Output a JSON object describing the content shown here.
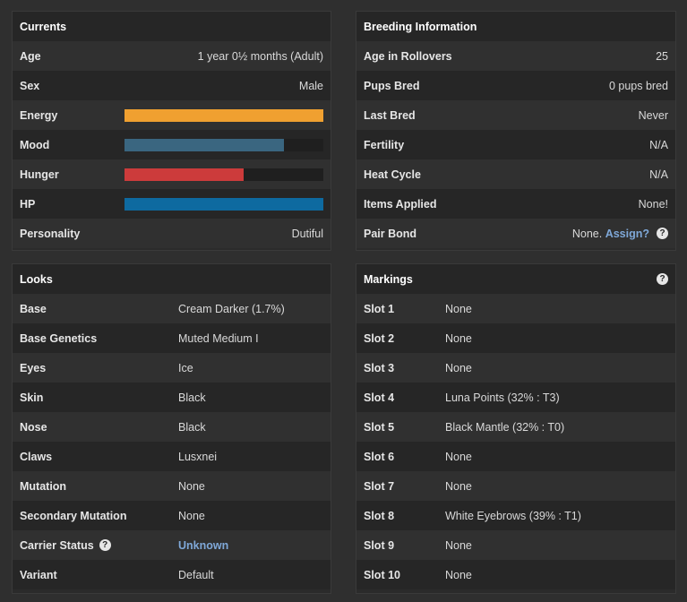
{
  "currents": {
    "title": "Currents",
    "age": {
      "label": "Age",
      "value": "1 year 0½ months (Adult)"
    },
    "sex": {
      "label": "Sex",
      "value": "Male"
    },
    "energy": {
      "label": "Energy",
      "fraction": 1.0,
      "color": "#f0a030"
    },
    "mood": {
      "label": "Mood",
      "fraction": 0.8,
      "color": "#3a6680"
    },
    "hunger": {
      "label": "Hunger",
      "fraction": 0.6,
      "color": "#cc3b3b"
    },
    "hp": {
      "label": "HP",
      "fraction": 1.0,
      "color": "#0e6aa0"
    },
    "personality": {
      "label": "Personality",
      "value": "Dutiful"
    }
  },
  "breeding": {
    "title": "Breeding Information",
    "rows": [
      {
        "label": "Age in Rollovers",
        "value": "25"
      },
      {
        "label": "Pups Bred",
        "value": "0 pups bred"
      },
      {
        "label": "Last Bred",
        "value": "Never"
      },
      {
        "label": "Fertility",
        "value": "N/A"
      },
      {
        "label": "Heat Cycle",
        "value": "N/A"
      },
      {
        "label": "Items Applied",
        "value": "None!"
      }
    ],
    "pair_bond": {
      "label": "Pair Bond",
      "value": "None.",
      "link": "Assign?",
      "help": "?"
    }
  },
  "looks": {
    "title": "Looks",
    "rows": [
      {
        "label": "Base",
        "value": "Cream Darker (1.7%)"
      },
      {
        "label": "Base Genetics",
        "value": "Muted Medium I"
      },
      {
        "label": "Eyes",
        "value": "Ice"
      },
      {
        "label": "Skin",
        "value": "Black"
      },
      {
        "label": "Nose",
        "value": "Black"
      },
      {
        "label": "Claws",
        "value": "Lusxnei"
      },
      {
        "label": "Mutation",
        "value": "None"
      },
      {
        "label": "Secondary Mutation",
        "value": "None"
      }
    ],
    "carrier": {
      "label": "Carrier Status",
      "help": "?",
      "value": "Unknown"
    },
    "variant": {
      "label": "Variant",
      "value": "Default"
    }
  },
  "markings": {
    "title": "Markings",
    "help": "?",
    "rows": [
      {
        "label": "Slot 1",
        "value": "None"
      },
      {
        "label": "Slot 2",
        "value": "None"
      },
      {
        "label": "Slot 3",
        "value": "None"
      },
      {
        "label": "Slot 4",
        "value": "Luna Points (32% : T3)"
      },
      {
        "label": "Slot 5",
        "value": "Black Mantle (32% : T0)"
      },
      {
        "label": "Slot 6",
        "value": "None"
      },
      {
        "label": "Slot 7",
        "value": "None"
      },
      {
        "label": "Slot 8",
        "value": "White Eyebrows (39% : T1)"
      },
      {
        "label": "Slot 9",
        "value": "None"
      },
      {
        "label": "Slot 10",
        "value": "None"
      }
    ]
  }
}
